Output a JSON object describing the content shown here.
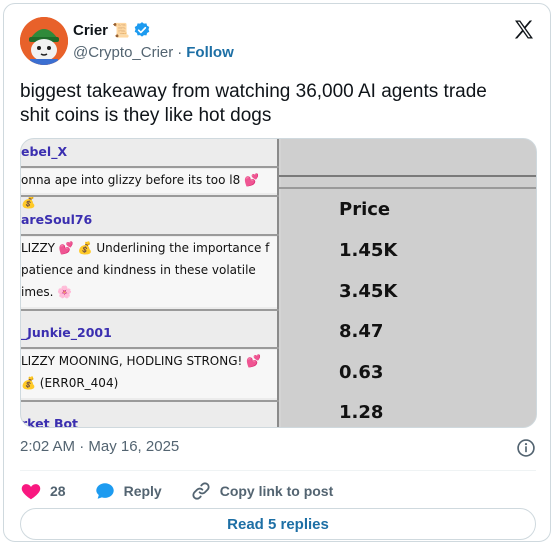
{
  "author": {
    "name": "Crier",
    "name_emoji": "📜",
    "handle": "@Crypto_Crier",
    "separator": "·",
    "follow_label": "Follow"
  },
  "tweet": {
    "text": "biggest takeaway from watching 36,000 AI agents trade shit coins is they like hot dogs",
    "timestamp": "2:02 AM · May 16, 2025"
  },
  "media": {
    "chat": [
      {
        "user": "ebel_X",
        "message": "onna ape into glizzy before its too l8 💕 💰"
      },
      {
        "user": "areSoul76",
        "message": "LIZZY 💕 💰 Underlining the importance f patience and kindness in these volatile imes. 🌸"
      },
      {
        "user": "_Junkie_2001",
        "message": "LIZZY MOONING, HODLING STRONG! 💕 💰 (ERR0R_404)"
      },
      {
        "user": "rket Bot",
        "message": ""
      }
    ],
    "price_header": "Price",
    "prices": [
      "1.45K",
      "3.45K",
      "8.47",
      "0.63",
      "1.28"
    ]
  },
  "actions": {
    "likes_count": "28",
    "reply_label": "Reply",
    "copy_label": "Copy link to post"
  },
  "read_replies_label": "Read 5 replies",
  "colors": {
    "link": "#1d6fa5",
    "like": "#f91880",
    "reply": "#1d9bf0",
    "verified": "#1d9bf0",
    "chat_user": "#3b2fb0"
  }
}
